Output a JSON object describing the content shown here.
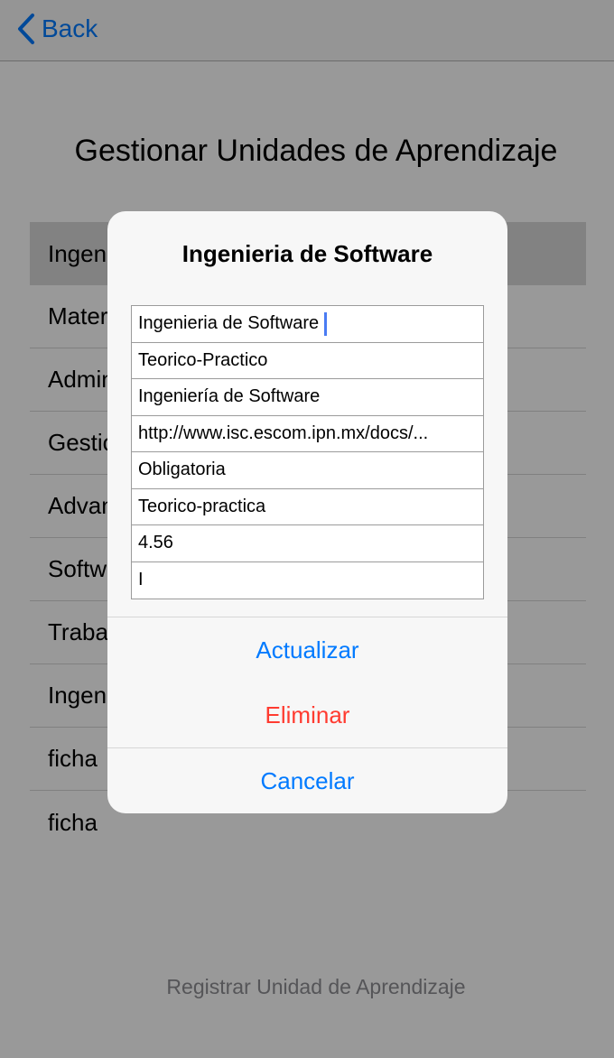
{
  "navbar": {
    "back_label": "Back"
  },
  "page": {
    "title": "Gestionar Unidades de Aprendizaje",
    "register_label": "Registrar Unidad de Aprendizaje"
  },
  "list": {
    "items": [
      {
        "label": "Ingenieria de Software"
      },
      {
        "label": "Materia"
      },
      {
        "label": "Administracion"
      },
      {
        "label": "Gestion"
      },
      {
        "label": "Advanced"
      },
      {
        "label": "Software Engineering Tools"
      },
      {
        "label": "Trabajo"
      },
      {
        "label": "Ingenieria"
      },
      {
        "label": "ficha"
      },
      {
        "label": "ficha"
      }
    ]
  },
  "alert": {
    "title": "Ingenieria de Software",
    "fields": [
      {
        "value": "Ingenieria de Software"
      },
      {
        "value": "Teorico-Practico"
      },
      {
        "value": "Ingeniería de Software"
      },
      {
        "value": "http://www.isc.escom.ipn.mx/docs/..."
      },
      {
        "value": "Obligatoria"
      },
      {
        "value": "Teorico-practica"
      },
      {
        "value": "4.56"
      },
      {
        "value": "I"
      }
    ],
    "actions": {
      "update_label": "Actualizar",
      "delete_label": "Eliminar",
      "cancel_label": "Cancelar"
    }
  },
  "colors": {
    "accent": "#007aff",
    "destructive": "#ff3b30",
    "caret": "#4a7cf3"
  }
}
